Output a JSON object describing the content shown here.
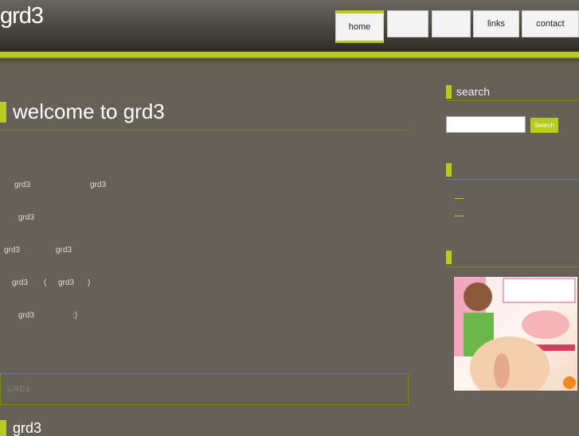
{
  "site": {
    "logo": "grd3"
  },
  "nav": [
    {
      "label": "home"
    },
    {
      "label": ""
    },
    {
      "label": ""
    },
    {
      "label": "links"
    },
    {
      "label": "contact"
    }
  ],
  "main": {
    "title": "welcome to grd3",
    "lines": [
      [
        "grd3",
        "grd3"
      ],
      [
        "grd3"
      ],
      [
        "grd3",
        "grd3"
      ],
      [
        "grd3",
        "(",
        "grd3",
        ")"
      ],
      [
        "grd3",
        ":)"
      ]
    ],
    "box_text": "GRD3",
    "section2_title": "grd3"
  },
  "sidebar": {
    "search_title": "search",
    "search_placeholder": "",
    "search_button": "Search"
  },
  "colors": {
    "accent": "#b7cc1c",
    "background": "#656159"
  }
}
